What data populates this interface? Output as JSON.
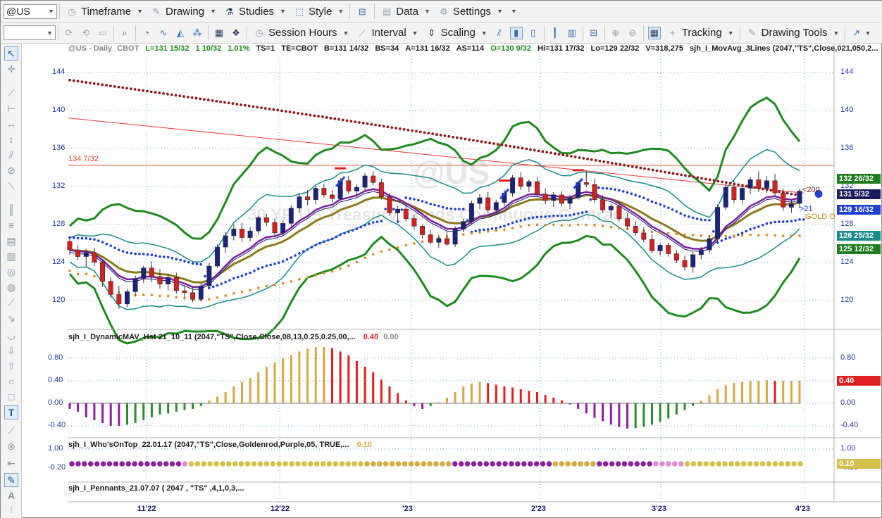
{
  "toolbar1": {
    "symbol_value": "@US",
    "timeframe": "Timeframe",
    "drawing": "Drawing",
    "studies": "Studies",
    "style": "Style",
    "data": "Data",
    "settings": "Settings"
  },
  "toolbar2": {
    "symbol_value": "",
    "session_hours": "Session Hours",
    "interval": "Interval",
    "scaling": "Scaling",
    "tracking": "Tracking",
    "drawing_tools": "Drawing Tools"
  },
  "header": {
    "symbol": "@US - Daily",
    "exchange": "CBOT",
    "last": "L=131 15/32",
    "change": "1 10/32",
    "change_pct": "1.01%",
    "ts": "TS=1",
    "te": "TE=CBOT",
    "bid": "B=131 14/32",
    "bs": "BS=34",
    "ask": "A=131 16/32",
    "as": "AS=114",
    "open": "O=130 9/32",
    "high": "Hi=131 17/32",
    "low": "Lo=129 22/32",
    "volume": "V=318,275",
    "study": "sjh_I_MovAvg_3Lines (2047,\"TS\",Close,021,050,2..."
  },
  "watermark": {
    "symbol": "@US",
    "description": "30 YR US Treasury Bonds Continuous Contract"
  },
  "price_panel": {
    "y_ticks": [
      "144",
      "140",
      "136",
      "132",
      "128",
      "124",
      "120"
    ],
    "hline_label": "134 7/32",
    "ma200_label": "<200",
    "ma21_label": ">21",
    "gold_label": "GOLD O",
    "right_tags": [
      {
        "text": "132 26/32",
        "color": "#1e7d1e"
      },
      {
        "text": "131 5/32",
        "color": "#1a1a5e"
      },
      {
        "text": "129 16/32",
        "color": "#1f3fd1"
      },
      {
        "text": "126 25/32",
        "color": "#1c8b8b"
      },
      {
        "text": "125 12/32",
        "color": "#1e7d1e"
      }
    ]
  },
  "osc_panel": {
    "title": "sjh_I_DynamicMAV_Hst 21_10_11 (2047,\"TS\",Close,Close,08,13,0.25,0.25,00,...",
    "value1": "0.40",
    "value2": "0.00",
    "y_ticks": [
      "0.80",
      "0.40",
      "0.00",
      "-0.40"
    ],
    "right_tag": "0.40"
  },
  "whos_panel": {
    "title": "sjh_I_Who'sOnTop_22.01.17 (2047,\"TS\",Close,Goldenrod,Purple,05, TRUE,...",
    "value": "0.10",
    "y_ticks": [
      "1.00",
      "-0.20"
    ],
    "right_tag": "0.10"
  },
  "pennants_panel": {
    "title": "sjh_I_Pennants_21.07.07 ( 2047 , \"TS\" ,4,1,0,3,..."
  },
  "x_axis": {
    "labels": [
      "11'22",
      "12'22",
      "'23",
      "2'23",
      "3'23",
      "4'23"
    ]
  },
  "chart_data": {
    "type": "candlestick",
    "instrument": "@US - Daily",
    "y_range": [
      117,
      146
    ],
    "ohlc": [
      [
        126.2,
        126.6,
        124.8,
        125.3
      ],
      [
        125.3,
        125.8,
        124.2,
        124.6
      ],
      [
        124.6,
        125.4,
        123.5,
        125.0
      ],
      [
        125.0,
        125.5,
        123.6,
        124.0
      ],
      [
        124.0,
        124.3,
        121.4,
        122.0
      ],
      [
        122.0,
        122.4,
        120.2,
        120.6
      ],
      [
        120.6,
        121.5,
        119.1,
        119.6
      ],
      [
        119.6,
        121.2,
        119.3,
        120.9
      ],
      [
        120.9,
        122.6,
        120.5,
        122.3
      ],
      [
        122.3,
        123.6,
        121.8,
        123.4
      ],
      [
        123.4,
        124.1,
        121.9,
        122.5
      ],
      [
        122.5,
        123.3,
        121.2,
        121.7
      ],
      [
        121.7,
        122.7,
        121.0,
        122.4
      ],
      [
        122.4,
        122.9,
        120.7,
        121.0
      ],
      [
        121.0,
        121.6,
        120.3,
        120.8
      ],
      [
        120.8,
        121.5,
        119.8,
        120.1
      ],
      [
        120.1,
        121.8,
        119.9,
        121.5
      ],
      [
        121.5,
        123.9,
        121.3,
        123.6
      ],
      [
        123.6,
        125.9,
        123.4,
        125.6
      ],
      [
        125.6,
        127.2,
        125.0,
        126.8
      ],
      [
        126.8,
        128.0,
        126.3,
        127.5
      ],
      [
        127.5,
        128.2,
        126.1,
        126.6
      ],
      [
        126.6,
        127.7,
        126.2,
        127.3
      ],
      [
        127.3,
        128.9,
        127.0,
        128.7
      ],
      [
        128.7,
        129.1,
        127.8,
        128.2
      ],
      [
        128.2,
        128.6,
        126.6,
        127.1
      ],
      [
        127.1,
        128.4,
        126.8,
        128.1
      ],
      [
        128.1,
        130.0,
        127.8,
        129.7
      ],
      [
        129.7,
        131.3,
        129.2,
        130.9
      ],
      [
        130.9,
        131.6,
        130.0,
        130.6
      ],
      [
        130.6,
        132.1,
        130.1,
        131.8
      ],
      [
        131.8,
        132.3,
        130.8,
        131.1
      ],
      [
        131.1,
        131.6,
        130.3,
        130.7
      ],
      [
        130.7,
        132.9,
        130.5,
        132.6
      ],
      [
        132.6,
        133.1,
        131.2,
        131.5
      ],
      [
        131.5,
        132.2,
        130.9,
        131.9
      ],
      [
        131.9,
        133.4,
        131.6,
        133.1
      ],
      [
        133.1,
        133.6,
        132.1,
        132.4
      ],
      [
        132.4,
        132.8,
        130.6,
        130.9
      ],
      [
        130.9,
        131.3,
        128.9,
        129.2
      ],
      [
        129.2,
        129.9,
        128.4,
        129.6
      ],
      [
        129.6,
        130.2,
        128.3,
        128.6
      ],
      [
        128.6,
        129.0,
        127.4,
        127.8
      ],
      [
        127.8,
        128.0,
        126.5,
        126.9
      ],
      [
        126.9,
        127.4,
        125.9,
        126.1
      ],
      [
        126.1,
        126.9,
        125.5,
        126.5
      ],
      [
        126.5,
        127.2,
        125.7,
        125.9
      ],
      [
        125.9,
        127.8,
        125.6,
        127.5
      ],
      [
        127.5,
        128.6,
        127.2,
        128.3
      ],
      [
        128.3,
        130.5,
        128.0,
        130.2
      ],
      [
        130.2,
        131.2,
        129.6,
        130.8
      ],
      [
        130.8,
        131.4,
        129.2,
        129.5
      ],
      [
        129.5,
        130.6,
        129.1,
        130.3
      ],
      [
        130.3,
        131.6,
        129.9,
        131.3
      ],
      [
        131.3,
        133.2,
        130.9,
        132.9
      ],
      [
        132.9,
        133.5,
        131.6,
        132.0
      ],
      [
        132.0,
        132.7,
        131.4,
        132.5
      ],
      [
        132.5,
        133.0,
        130.9,
        131.2
      ],
      [
        131.2,
        131.8,
        130.1,
        130.5
      ],
      [
        130.5,
        131.4,
        129.8,
        131.1
      ],
      [
        131.1,
        131.5,
        129.9,
        130.2
      ],
      [
        130.2,
        131.1,
        129.6,
        130.8
      ],
      [
        130.8,
        132.6,
        130.6,
        132.4
      ],
      [
        132.4,
        133.6,
        131.9,
        132.2
      ],
      [
        132.2,
        132.8,
        130.3,
        130.6
      ],
      [
        130.6,
        131.1,
        129.2,
        129.5
      ],
      [
        129.5,
        130.2,
        128.7,
        129.9
      ],
      [
        129.9,
        130.4,
        128.3,
        128.6
      ],
      [
        128.6,
        129.2,
        127.5,
        127.8
      ],
      [
        127.8,
        128.3,
        126.8,
        127.1
      ],
      [
        127.1,
        127.7,
        126.1,
        126.4
      ],
      [
        126.4,
        126.9,
        124.9,
        125.2
      ],
      [
        125.2,
        126.0,
        124.7,
        125.8
      ],
      [
        125.8,
        126.1,
        124.6,
        124.9
      ],
      [
        124.9,
        125.3,
        123.9,
        124.2
      ],
      [
        124.2,
        124.7,
        123.1,
        123.5
      ],
      [
        123.5,
        125.1,
        122.9,
        124.8
      ],
      [
        124.8,
        125.6,
        124.3,
        125.3
      ],
      [
        125.3,
        126.8,
        125.0,
        126.5
      ],
      [
        126.5,
        130.1,
        126.2,
        129.8
      ],
      [
        129.8,
        132.2,
        129.5,
        131.9
      ],
      [
        131.9,
        132.6,
        130.2,
        130.6
      ],
      [
        130.6,
        132.1,
        130.1,
        131.8
      ],
      [
        131.8,
        133.0,
        131.2,
        132.7
      ],
      [
        132.7,
        133.6,
        131.4,
        131.8
      ],
      [
        131.8,
        133.1,
        131.3,
        132.6
      ],
      [
        132.6,
        133.3,
        131.0,
        131.3
      ],
      [
        131.3,
        131.7,
        129.4,
        129.8
      ],
      [
        129.8,
        130.6,
        129.2,
        130.2
      ],
      [
        130.2,
        131.7,
        129.7,
        131.5
      ]
    ],
    "histogram": [
      -0.1,
      -0.15,
      -0.25,
      -0.3,
      -0.35,
      -0.4,
      -0.4,
      -0.38,
      -0.35,
      -0.3,
      -0.25,
      -0.2,
      -0.18,
      -0.15,
      -0.12,
      -0.1,
      -0.05,
      0.05,
      0.12,
      0.2,
      0.3,
      0.38,
      0.45,
      0.55,
      0.65,
      0.72,
      0.8,
      0.86,
      0.92,
      0.97,
      1.0,
      1.0,
      0.98,
      0.92,
      0.85,
      0.75,
      0.65,
      0.55,
      0.42,
      0.3,
      0.18,
      0.05,
      -0.05,
      -0.1,
      -0.05,
      0.02,
      0.1,
      0.2,
      0.3,
      0.35,
      0.38,
      0.36,
      0.33,
      0.3,
      0.28,
      0.25,
      0.22,
      0.2,
      0.15,
      0.1,
      0.05,
      -0.02,
      -0.1,
      -0.18,
      -0.26,
      -0.32,
      -0.38,
      -0.42,
      -0.45,
      -0.44,
      -0.42,
      -0.38,
      -0.33,
      -0.27,
      -0.2,
      -0.12,
      -0.05,
      0.05,
      0.15,
      0.25,
      0.32,
      0.36,
      0.38,
      0.4,
      0.4,
      0.41,
      0.4,
      0.4,
      0.4,
      0.4
    ]
  },
  "colors": {
    "up_candle": "#1a237e",
    "down_candle": "#d61f1f",
    "band_outer": "#1e8a1e",
    "band_inner": "#1c8b8b",
    "ma_dots_blue": "#1f3fd1",
    "ma_dots_orange": "#d98a1e",
    "ma_dots_maroon": "#8b1a1a",
    "ma_purple": "#7b1fa2",
    "ma_olive": "#8a7a1a",
    "trendline": "#e53935",
    "hist_gold": "#d4a843",
    "hist_red": "#e02020",
    "hist_purple": "#8e1f9e",
    "hist_green": "#2e8b2e"
  }
}
